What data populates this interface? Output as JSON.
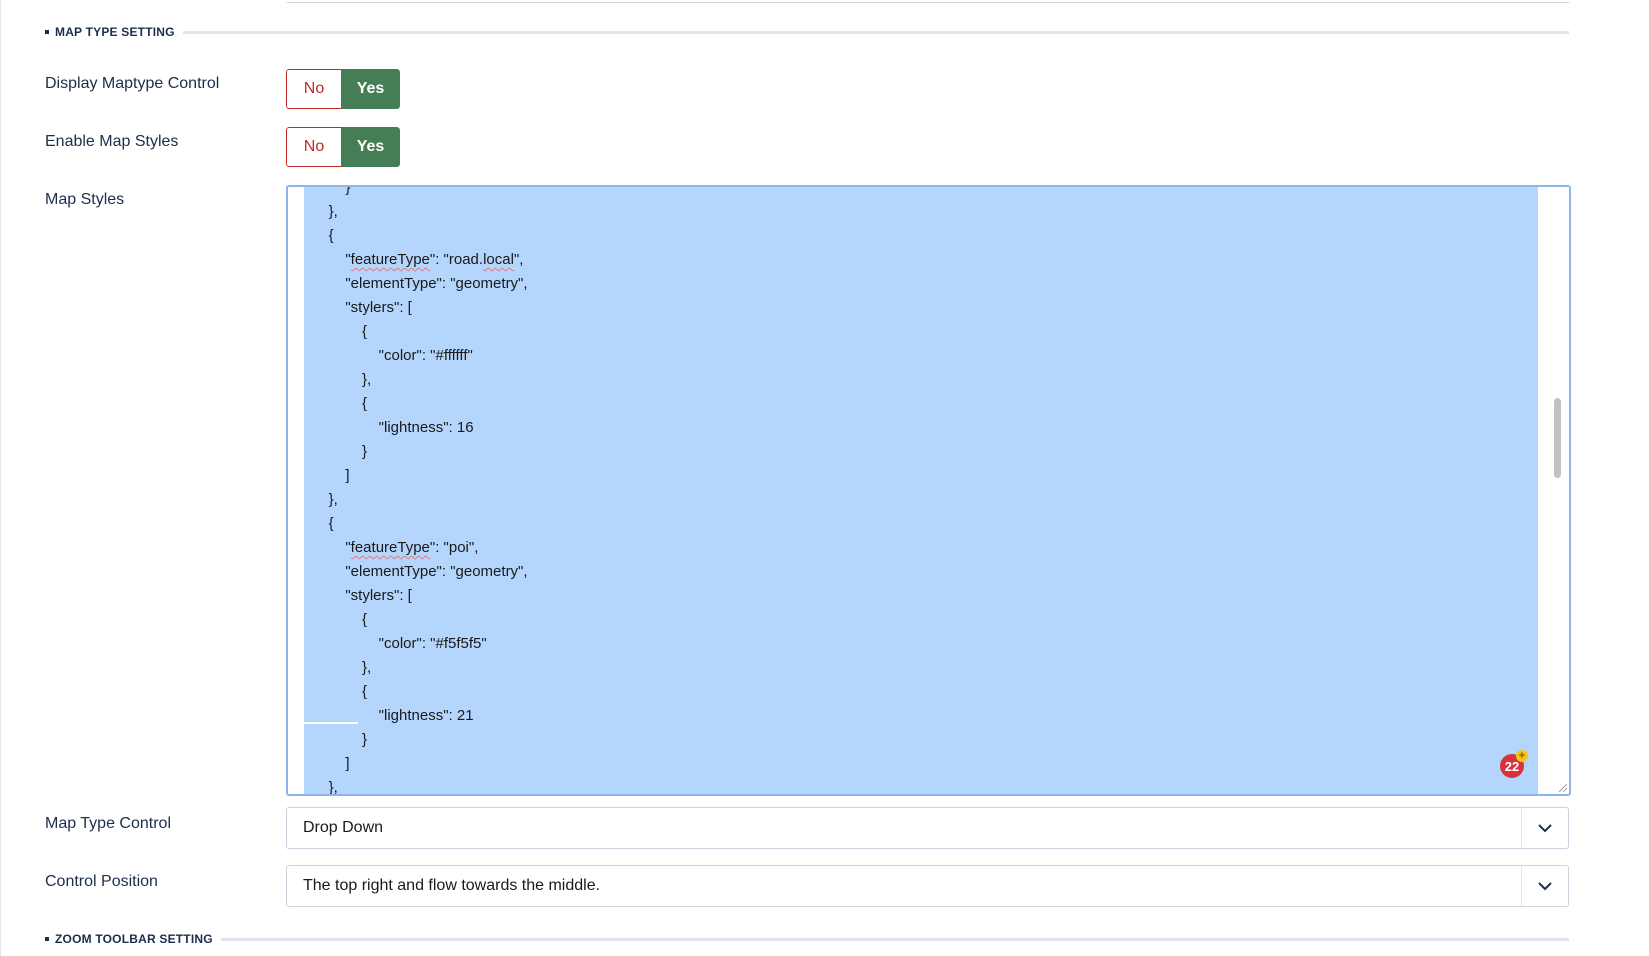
{
  "map_type_section": {
    "title": "MAP TYPE SETTING"
  },
  "display_maptype_control": {
    "label": "Display Maptype Control",
    "no": "No",
    "yes": "Yes",
    "selected": "Yes"
  },
  "enable_map_styles": {
    "label": "Enable Map Styles",
    "no": "No",
    "yes": "Yes",
    "selected": "Yes"
  },
  "map_styles": {
    "label": "Map Styles",
    "lines": [
      "        }",
      "    },",
      "    {",
      "        \"featureType\": \"road.local\",",
      "        \"elementType\": \"geometry\",",
      "        \"stylers\": [",
      "            {",
      "                \"color\": \"#ffffff\"",
      "            },",
      "            {",
      "                \"lightness\": 16",
      "            }",
      "        ]",
      "    },",
      "    {",
      "        \"featureType\": \"poi\",",
      "        \"elementType\": \"geometry\",",
      "        \"stylers\": [",
      "            {",
      "                \"color\": \"#f5f5f5\"",
      "            },",
      "            {",
      "                \"lightness\": 21",
      "            }",
      "        ]",
      "    },"
    ],
    "badge_count": "22",
    "badge_plus": "+"
  },
  "map_type_control": {
    "label": "Map Type Control",
    "value": "Drop Down"
  },
  "control_position": {
    "label": "Control Position",
    "value": "The top right and flow towards the middle."
  },
  "zoom_toolbar_section": {
    "title": "ZOOM TOOLBAR SETTING"
  },
  "colors": {
    "accent_green": "#457d54",
    "no_red": "#c52827",
    "selection_blue": "#b4d5fc",
    "text_navy": "#1c2e4a"
  },
  "icons": {
    "dropdown": "chevron-down-icon",
    "resize": "resize-grip-icon"
  }
}
